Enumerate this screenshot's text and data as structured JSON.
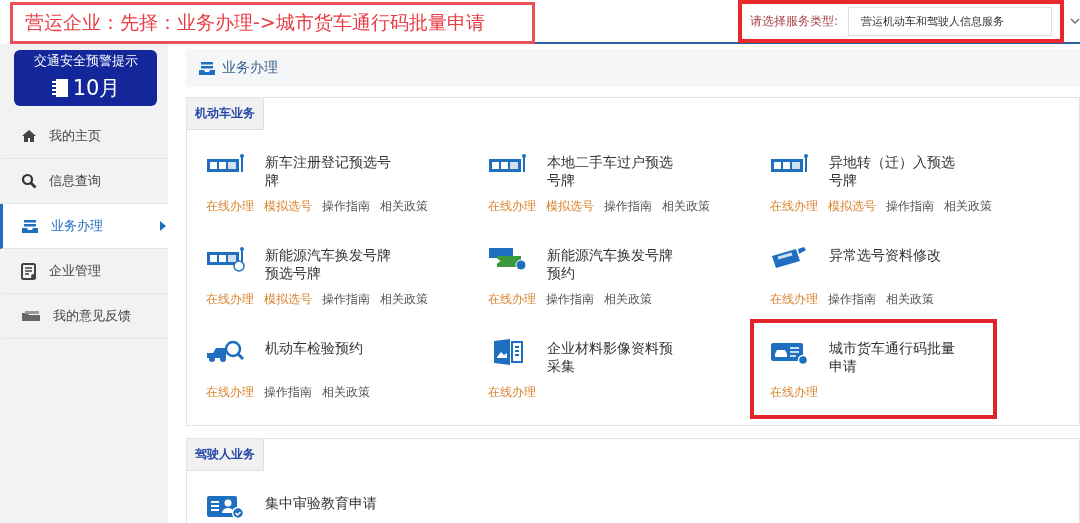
{
  "annotation": {
    "text": "营运企业：先择：业务办理->城市货车通行码批量申请"
  },
  "service_type": {
    "label": "请选择服务类型:",
    "value": "营运机动车和驾驶人信息服务",
    "highlighted": true
  },
  "banner": {
    "title": "交通安全预警提示",
    "month": "10月"
  },
  "sidebar": {
    "items": [
      {
        "label": "我的主页",
        "selected": false
      },
      {
        "label": "信息查询",
        "selected": false
      },
      {
        "label": "业务办理",
        "selected": true
      },
      {
        "label": "企业管理",
        "selected": false
      },
      {
        "label": "我的意见反馈",
        "selected": false
      }
    ]
  },
  "breadcrumb": {
    "label": "业务办理"
  },
  "sections": [
    {
      "title": "机动车业务",
      "items": [
        {
          "title": "新车注册登记预选号牌",
          "kind": "plate",
          "highlighted": false,
          "links": [
            {
              "label": "在线办理",
              "kind": "action"
            },
            {
              "label": "模拟选号",
              "kind": "action"
            },
            {
              "label": "操作指南",
              "kind": "info"
            },
            {
              "label": "相关政策",
              "kind": "info"
            }
          ]
        },
        {
          "title": "本地二手车过户预选号牌",
          "kind": "plate",
          "highlighted": false,
          "links": [
            {
              "label": "在线办理",
              "kind": "action"
            },
            {
              "label": "模拟选号",
              "kind": "action"
            },
            {
              "label": "操作指南",
              "kind": "info"
            },
            {
              "label": "相关政策",
              "kind": "info"
            }
          ]
        },
        {
          "title": "异地转（迁）入预选号牌",
          "kind": "plate",
          "highlighted": false,
          "links": [
            {
              "label": "在线办理",
              "kind": "action"
            },
            {
              "label": "模拟选号",
              "kind": "action"
            },
            {
              "label": "操作指南",
              "kind": "info"
            },
            {
              "label": "相关政策",
              "kind": "info"
            }
          ]
        },
        {
          "title": "新能源汽车换发号牌预选号牌",
          "kind": "renew",
          "highlighted": false,
          "links": [
            {
              "label": "在线办理",
              "kind": "action"
            },
            {
              "label": "模拟选号",
              "kind": "action"
            },
            {
              "label": "操作指南",
              "kind": "info"
            },
            {
              "label": "相关政策",
              "kind": "info"
            }
          ]
        },
        {
          "title": "新能源汽车换发号牌预约",
          "kind": "swap",
          "highlighted": false,
          "links": [
            {
              "label": "在线办理",
              "kind": "action"
            },
            {
              "label": "操作指南",
              "kind": "info"
            },
            {
              "label": "相关政策",
              "kind": "info"
            }
          ]
        },
        {
          "title": "异常选号资料修改",
          "kind": "edit",
          "highlighted": false,
          "links": [
            {
              "label": "在线办理",
              "kind": "action"
            },
            {
              "label": "操作指南",
              "kind": "info"
            },
            {
              "label": "相关政策",
              "kind": "info"
            }
          ]
        },
        {
          "title": "机动车检验预约",
          "kind": "inspection",
          "highlighted": false,
          "links": [
            {
              "label": "在线办理",
              "kind": "action"
            },
            {
              "label": "操作指南",
              "kind": "info"
            },
            {
              "label": "相关政策",
              "kind": "info"
            }
          ]
        },
        {
          "title": "企业材料影像资料预采集",
          "kind": "material",
          "highlighted": false,
          "links": [
            {
              "label": "在线办理",
              "kind": "action"
            }
          ]
        },
        {
          "title": "城市货车通行码批量申请",
          "kind": "pass",
          "highlighted": true,
          "links": [
            {
              "label": "在线办理",
              "kind": "action"
            }
          ]
        }
      ]
    },
    {
      "title": "驾驶人业务",
      "items": [
        {
          "title": "集中审验教育申请",
          "kind": "education",
          "highlighted": false
        }
      ]
    }
  ]
}
